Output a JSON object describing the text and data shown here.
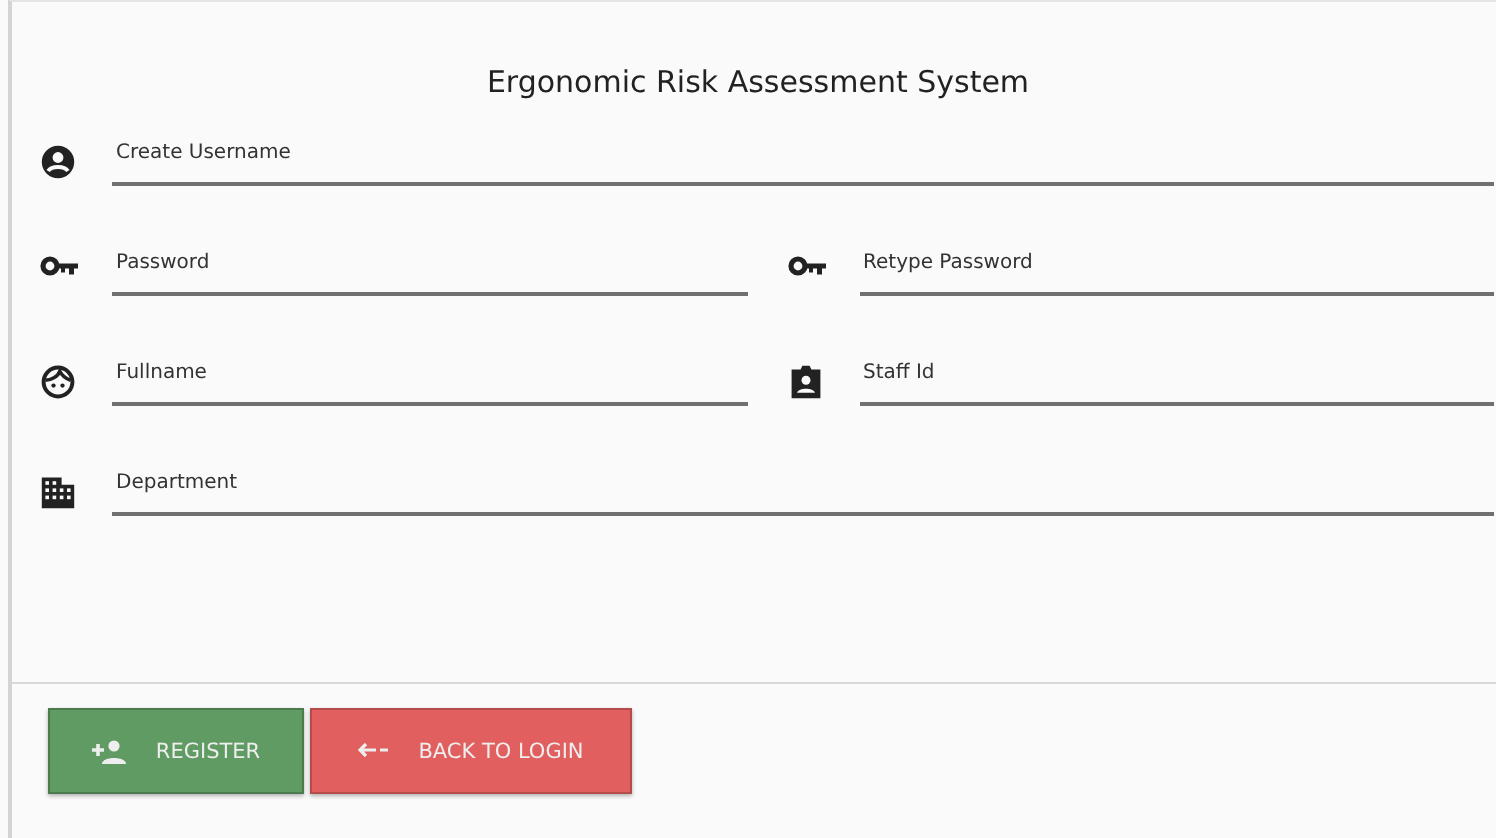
{
  "title": "Ergonomic Risk Assessment System",
  "rows": [
    {
      "fields": [
        {
          "kind": "user",
          "placeholder": "Create Username"
        }
      ]
    },
    {
      "fields": [
        {
          "kind": "key",
          "placeholder": "Password"
        },
        {
          "kind": "key",
          "placeholder": "Retype Password"
        }
      ]
    },
    {
      "fields": [
        {
          "kind": "face",
          "placeholder": "Fullname"
        },
        {
          "kind": "badge",
          "placeholder": "Staff Id"
        }
      ]
    },
    {
      "fields": [
        {
          "kind": "building",
          "placeholder": "Department"
        }
      ]
    }
  ],
  "buttons": [
    {
      "kind": "register",
      "label": "REGISTER"
    },
    {
      "kind": "back",
      "label": "BACK TO LOGIN"
    }
  ]
}
